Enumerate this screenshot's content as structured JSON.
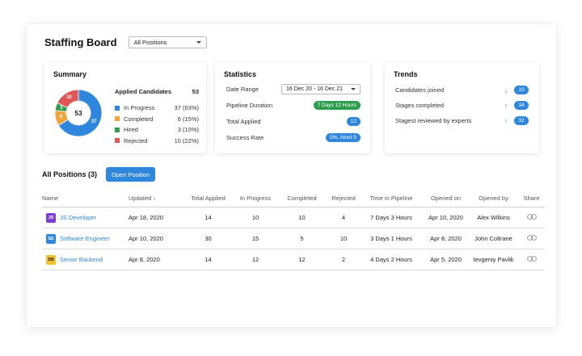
{
  "header": {
    "title": "Staffing Board",
    "position_select": "All Positions"
  },
  "summary": {
    "title": "Summary",
    "total": "53",
    "applied_label": "Applied Candidates",
    "applied_value": "53",
    "segments": [
      {
        "name": "In Progress",
        "value": 37,
        "label": "37",
        "display": "37 (63%)",
        "color": "#2f87dd"
      },
      {
        "name": "Completed",
        "value": 6,
        "label": "6",
        "display": "6 (15%)",
        "color": "#f2a33a"
      },
      {
        "name": "Hired",
        "value": 3,
        "label": "3",
        "display": "3 (10%)",
        "color": "#2e9d4f"
      },
      {
        "name": "Rejected",
        "value": 10,
        "label": "10",
        "display": "10 (22%)",
        "color": "#e05555"
      }
    ]
  },
  "statistics": {
    "title": "Statistics",
    "date_range_label": "Date Range",
    "date_range_value": "16 Dec 20 - 16 Dec 21",
    "pipeline_label": "Pipeline Duration",
    "pipeline_value": "7 Days 12 Hours",
    "total_applied_label": "Total Applied",
    "total_applied_value": "12",
    "success_label": "Success Rate",
    "success_value": "5%, hired 5"
  },
  "trends": {
    "title": "Trends",
    "items": [
      {
        "label": "Candidates joined",
        "direction": "down",
        "value": "10"
      },
      {
        "label": "Stages completed",
        "direction": "up",
        "value": "34"
      },
      {
        "label": "Stagest reviewed by experts",
        "direction": "up",
        "value": "32"
      }
    ]
  },
  "positions": {
    "title": "All Positions (3)",
    "open_button": "Open Position",
    "columns": {
      "name": "Name",
      "updated": "Updated ↓",
      "total_applied": "Total Applied",
      "in_progress": "In Progress",
      "completed": "Completed",
      "rejected": "Rejected",
      "time_in_pipeline": "Time in Pipeline",
      "opened_on": "Opened on",
      "opened_by": "Opened by",
      "share": "Share"
    },
    "rows": [
      {
        "badge": "JS",
        "badge_bg": "#7b3fd6",
        "badge_fg": "#ffffff",
        "name": "JS Developer",
        "updated": "Apr 18, 2020",
        "total_applied": "14",
        "in_progress": "10",
        "completed": "10",
        "rejected": "4",
        "time_in_pipeline": "7 Days 3 Hours",
        "opened_on": "Apr 10, 2020",
        "opened_by": "Alex Wilkins"
      },
      {
        "badge": "SE",
        "badge_bg": "#2f87dd",
        "badge_fg": "#ffffff",
        "name": "Software Engineer",
        "updated": "Apr 10, 2020",
        "total_applied": "30",
        "in_progress": "15",
        "completed": "5",
        "rejected": "10",
        "time_in_pipeline": "3 Days 1 Hours",
        "opened_on": "Apr 8, 2020",
        "opened_by": "John Coltrane"
      },
      {
        "badge": "SB",
        "badge_bg": "#f2c230",
        "badge_fg": "#222222",
        "name": "Senior Backend",
        "updated": "Apr 8, 2020",
        "total_applied": "14",
        "in_progress": "12",
        "completed": "12",
        "rejected": "2",
        "time_in_pipeline": "4 Days 2 Hours",
        "opened_on": "Apr 5, 2020",
        "opened_by": "Ievgeniy Pavlik"
      }
    ]
  }
}
